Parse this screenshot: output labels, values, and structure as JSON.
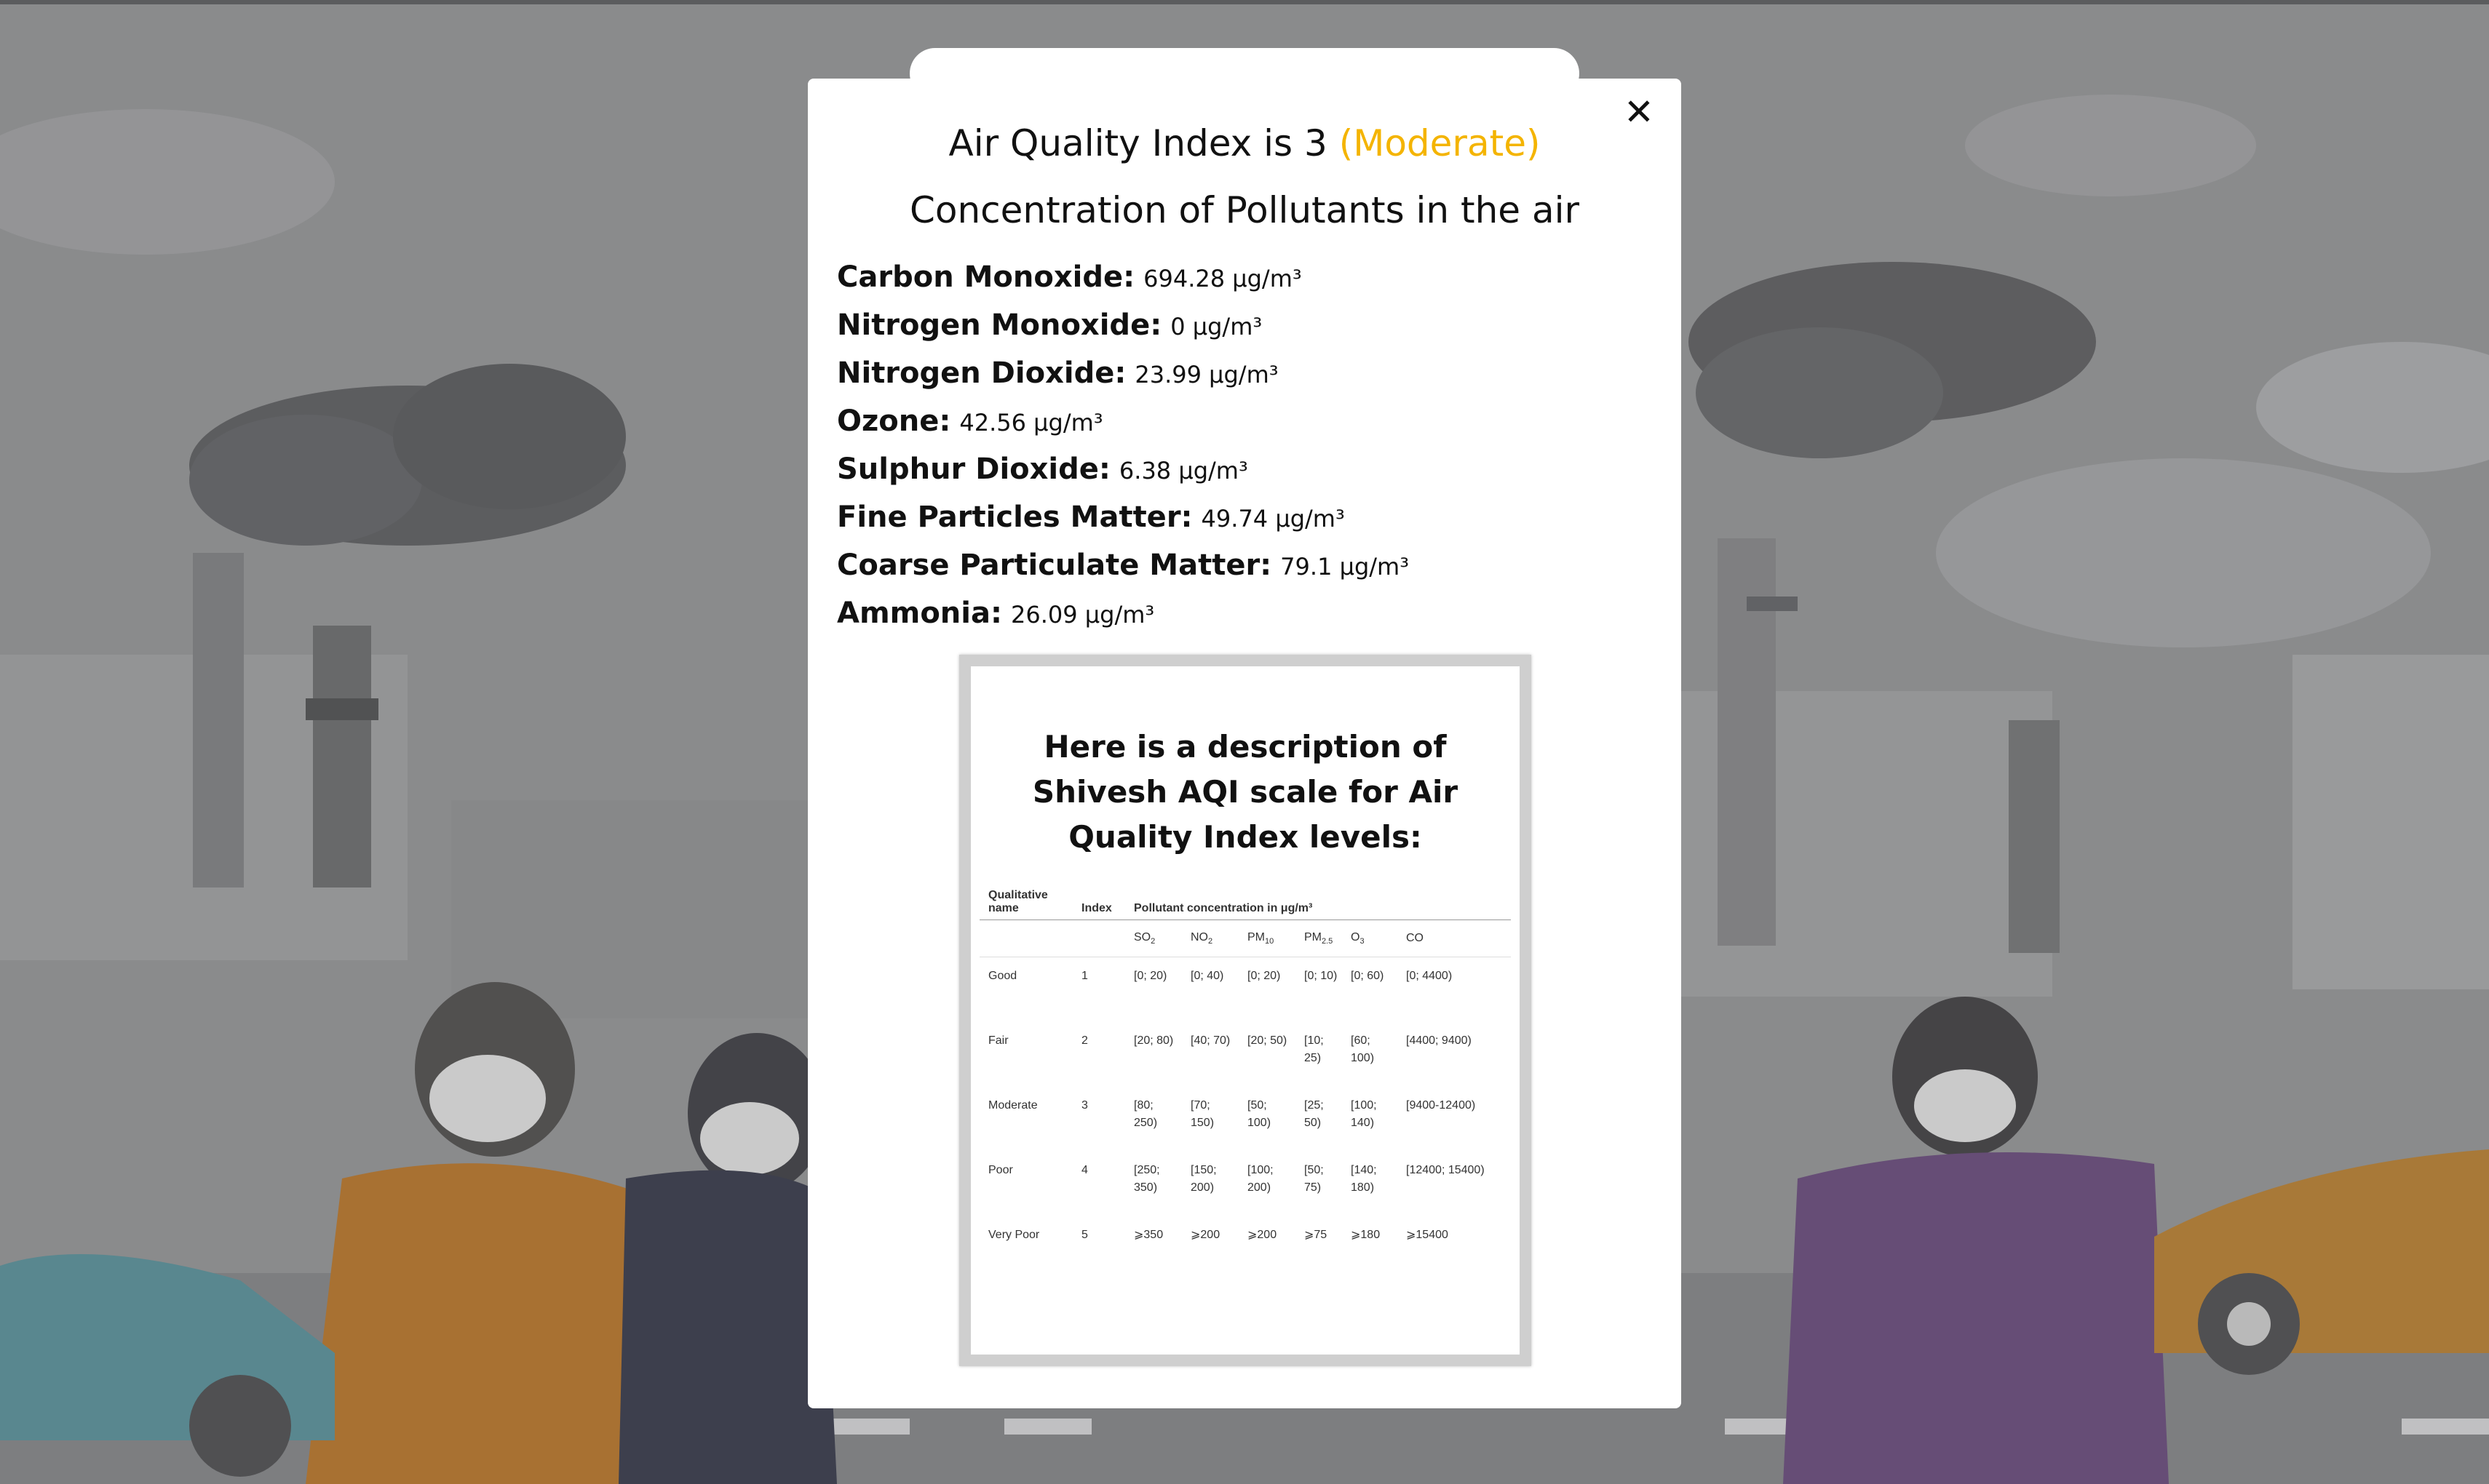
{
  "modal": {
    "title_prefix": "Air Quality Index is 3",
    "aqi_level": "(Moderate)",
    "section_title": "Concentration of Pollutants in the air",
    "close_symbol": "✕",
    "pollutants": [
      {
        "name": "Carbon Monoxide:",
        "value": "694.28 μg/m³"
      },
      {
        "name": "Nitrogen Monoxide:",
        "value": "0 μg/m³"
      },
      {
        "name": "Nitrogen Dioxide:",
        "value": "23.99 μg/m³"
      },
      {
        "name": "Ozone:",
        "value": "42.56 μg/m³"
      },
      {
        "name": "Sulphur Dioxide:",
        "value": "6.38 μg/m³"
      },
      {
        "name": "Fine Particles Matter:",
        "value": "49.74 μg/m³"
      },
      {
        "name": "Coarse Particulate Matter:",
        "value": "79.1 μg/m³"
      },
      {
        "name": "Ammonia:",
        "value": "26.09 μg/m³"
      }
    ]
  },
  "scale_card": {
    "title": "Here is a description of Shivesh AQI scale for Air Quality Index levels:",
    "headers": {
      "qualitative": "Qualitative name",
      "index": "Index",
      "concentration": "Pollutant concentration in μg/m³"
    },
    "subheaders": {
      "so2": "SO",
      "so2_sub": "2",
      "no2": "NO",
      "no2_sub": "2",
      "pm10": "PM",
      "pm10_sub": "10",
      "pm25": "PM",
      "pm25_sub": "2.5",
      "o3": "O",
      "o3_sub": "3",
      "co": "CO"
    },
    "rows": [
      {
        "name": "Good",
        "index": "1",
        "so2": "[0; 20)",
        "no2": "[0; 40)",
        "pm10": "[0; 20)",
        "pm25": "[0; 10)",
        "o3": "[0; 60)",
        "co": "[0; 4400)"
      },
      {
        "name": "Fair",
        "index": "2",
        "so2": "[20; 80)",
        "no2": "[40; 70)",
        "pm10": "[20; 50)",
        "pm25": "[10; 25)",
        "o3": "[60; 100)",
        "co": "[4400; 9400)"
      },
      {
        "name": "Moderate",
        "index": "3",
        "so2": "[80; 250)",
        "no2": "[70; 150)",
        "pm10": "[50; 100)",
        "pm25": "[25; 50)",
        "o3": "[100; 140)",
        "co": "[9400-12400)"
      },
      {
        "name": "Poor",
        "index": "4",
        "so2": "[250; 350)",
        "no2": "[150; 200)",
        "pm10": "[100; 200)",
        "pm25": "[50; 75)",
        "o3": "[140; 180)",
        "co": "[12400; 15400)"
      },
      {
        "name": "Very Poor",
        "index": "5",
        "so2": "⩾350",
        "no2": "⩾200",
        "pm10": "⩾200",
        "pm25": "⩾75",
        "o3": "⩾180",
        "co": "⩾15400"
      }
    ]
  },
  "colors": {
    "moderate": "#f4b400",
    "background": "#8f9092"
  }
}
